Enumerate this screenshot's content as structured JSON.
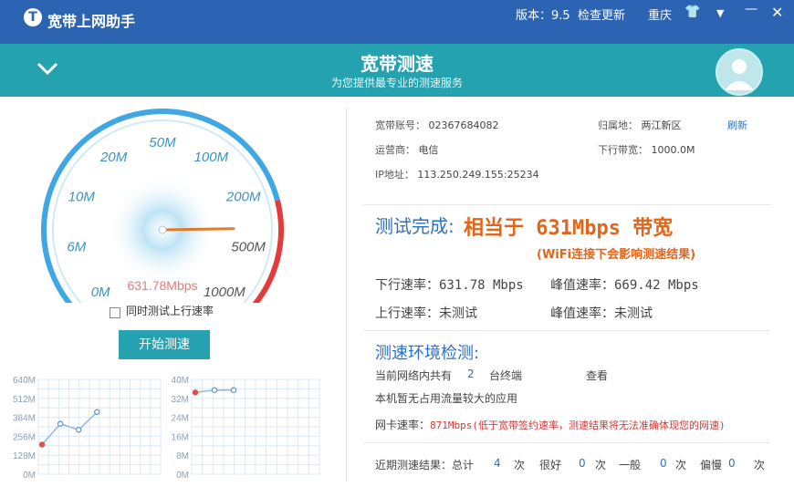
{
  "titlebar": {
    "app_title": "宽带上网助手",
    "version": "版本：9.5",
    "check_update": "检查更新",
    "city": "重庆"
  },
  "banner": {
    "title": "宽带测速",
    "subtitle": "为您提供最专业的测速服务"
  },
  "gauge": {
    "ticks": [
      "0M",
      "6M",
      "10M",
      "20M",
      "50M",
      "100M",
      "200M",
      "500M",
      "1000M"
    ],
    "reading": "631.78Mbps",
    "needle_fraction": 0.83,
    "colors": {
      "blue": "#3fa7e3",
      "red": "#e13b3b",
      "needle": "#e07a2c"
    }
  },
  "controls": {
    "upload_test_label": "同时测试上行速率",
    "upload_test_checked": false,
    "start_button": "开始测速"
  },
  "download_chart": {
    "ticks": [
      "640M",
      "512M",
      "384M",
      "256M",
      "128M",
      "0M"
    ],
    "values": [
      200,
      340,
      300,
      420
    ]
  },
  "upload_chart": {
    "ticks": [
      "40M",
      "32M",
      "24M",
      "16M",
      "8M",
      "0M"
    ],
    "values": [
      34.5,
      35.5,
      35.5
    ]
  },
  "account": {
    "account_label": "宽带账号：",
    "account_value": "02367684082",
    "location_label": "归属地：",
    "location_value": "两江新区",
    "refresh": "刷新",
    "isp_label": "运营商：",
    "isp_value": "电信",
    "bandwidth_label": "下行带宽：",
    "bandwidth_value": "1000.0M",
    "ip_label": "IP地址：",
    "ip_value": "113.250.249.155:25234"
  },
  "result": {
    "heading": "测试完成:",
    "equivalent": "相当于 631Mbps 带宽",
    "note": "(WiFi连接下会影响测速结果)",
    "down_label": "下行速率：",
    "down_value": "631.78 Mbps",
    "peak_down_label": "峰值速率：",
    "peak_down_value": "669.42 Mbps",
    "up_label": "上行速率：",
    "up_value": "未测试",
    "peak_up_label": "峰值速率：",
    "peak_up_value": "未测试"
  },
  "environment": {
    "heading": "测速环境检测:",
    "devices_prefix": "当前网络内共有",
    "devices_count": "2",
    "devices_suffix": "台终端",
    "view": "查看",
    "no_heavy_apps": "本机暂无占用流量较大的应用",
    "nic_label": "网卡速率：",
    "nic_warning": "871Mbps(低于宽带签约速率，测速结果将无法准确体现您的网速)"
  },
  "history": {
    "label": "近期测速结果：总计",
    "total": "4",
    "unit": "次",
    "good_label": "很好",
    "good_count": "0",
    "normal_label": "一般",
    "normal_count": "0",
    "slow_label": "偏慢",
    "slow_count": "0"
  }
}
